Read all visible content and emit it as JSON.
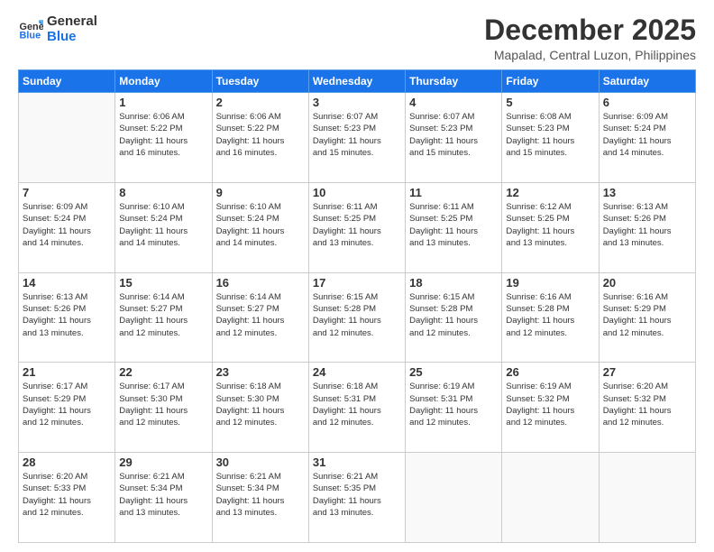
{
  "header": {
    "logo_general": "General",
    "logo_blue": "Blue",
    "main_title": "December 2025",
    "subtitle": "Mapalad, Central Luzon, Philippines"
  },
  "calendar": {
    "days_of_week": [
      "Sunday",
      "Monday",
      "Tuesday",
      "Wednesday",
      "Thursday",
      "Friday",
      "Saturday"
    ],
    "weeks": [
      [
        {
          "day": "",
          "info": ""
        },
        {
          "day": "1",
          "info": "Sunrise: 6:06 AM\nSunset: 5:22 PM\nDaylight: 11 hours\nand 16 minutes."
        },
        {
          "day": "2",
          "info": "Sunrise: 6:06 AM\nSunset: 5:22 PM\nDaylight: 11 hours\nand 16 minutes."
        },
        {
          "day": "3",
          "info": "Sunrise: 6:07 AM\nSunset: 5:23 PM\nDaylight: 11 hours\nand 15 minutes."
        },
        {
          "day": "4",
          "info": "Sunrise: 6:07 AM\nSunset: 5:23 PM\nDaylight: 11 hours\nand 15 minutes."
        },
        {
          "day": "5",
          "info": "Sunrise: 6:08 AM\nSunset: 5:23 PM\nDaylight: 11 hours\nand 15 minutes."
        },
        {
          "day": "6",
          "info": "Sunrise: 6:09 AM\nSunset: 5:24 PM\nDaylight: 11 hours\nand 14 minutes."
        }
      ],
      [
        {
          "day": "7",
          "info": "Sunrise: 6:09 AM\nSunset: 5:24 PM\nDaylight: 11 hours\nand 14 minutes."
        },
        {
          "day": "8",
          "info": "Sunrise: 6:10 AM\nSunset: 5:24 PM\nDaylight: 11 hours\nand 14 minutes."
        },
        {
          "day": "9",
          "info": "Sunrise: 6:10 AM\nSunset: 5:24 PM\nDaylight: 11 hours\nand 14 minutes."
        },
        {
          "day": "10",
          "info": "Sunrise: 6:11 AM\nSunset: 5:25 PM\nDaylight: 11 hours\nand 13 minutes."
        },
        {
          "day": "11",
          "info": "Sunrise: 6:11 AM\nSunset: 5:25 PM\nDaylight: 11 hours\nand 13 minutes."
        },
        {
          "day": "12",
          "info": "Sunrise: 6:12 AM\nSunset: 5:25 PM\nDaylight: 11 hours\nand 13 minutes."
        },
        {
          "day": "13",
          "info": "Sunrise: 6:13 AM\nSunset: 5:26 PM\nDaylight: 11 hours\nand 13 minutes."
        }
      ],
      [
        {
          "day": "14",
          "info": "Sunrise: 6:13 AM\nSunset: 5:26 PM\nDaylight: 11 hours\nand 13 minutes."
        },
        {
          "day": "15",
          "info": "Sunrise: 6:14 AM\nSunset: 5:27 PM\nDaylight: 11 hours\nand 12 minutes."
        },
        {
          "day": "16",
          "info": "Sunrise: 6:14 AM\nSunset: 5:27 PM\nDaylight: 11 hours\nand 12 minutes."
        },
        {
          "day": "17",
          "info": "Sunrise: 6:15 AM\nSunset: 5:28 PM\nDaylight: 11 hours\nand 12 minutes."
        },
        {
          "day": "18",
          "info": "Sunrise: 6:15 AM\nSunset: 5:28 PM\nDaylight: 11 hours\nand 12 minutes."
        },
        {
          "day": "19",
          "info": "Sunrise: 6:16 AM\nSunset: 5:28 PM\nDaylight: 11 hours\nand 12 minutes."
        },
        {
          "day": "20",
          "info": "Sunrise: 6:16 AM\nSunset: 5:29 PM\nDaylight: 11 hours\nand 12 minutes."
        }
      ],
      [
        {
          "day": "21",
          "info": "Sunrise: 6:17 AM\nSunset: 5:29 PM\nDaylight: 11 hours\nand 12 minutes."
        },
        {
          "day": "22",
          "info": "Sunrise: 6:17 AM\nSunset: 5:30 PM\nDaylight: 11 hours\nand 12 minutes."
        },
        {
          "day": "23",
          "info": "Sunrise: 6:18 AM\nSunset: 5:30 PM\nDaylight: 11 hours\nand 12 minutes."
        },
        {
          "day": "24",
          "info": "Sunrise: 6:18 AM\nSunset: 5:31 PM\nDaylight: 11 hours\nand 12 minutes."
        },
        {
          "day": "25",
          "info": "Sunrise: 6:19 AM\nSunset: 5:31 PM\nDaylight: 11 hours\nand 12 minutes."
        },
        {
          "day": "26",
          "info": "Sunrise: 6:19 AM\nSunset: 5:32 PM\nDaylight: 11 hours\nand 12 minutes."
        },
        {
          "day": "27",
          "info": "Sunrise: 6:20 AM\nSunset: 5:32 PM\nDaylight: 11 hours\nand 12 minutes."
        }
      ],
      [
        {
          "day": "28",
          "info": "Sunrise: 6:20 AM\nSunset: 5:33 PM\nDaylight: 11 hours\nand 12 minutes."
        },
        {
          "day": "29",
          "info": "Sunrise: 6:21 AM\nSunset: 5:34 PM\nDaylight: 11 hours\nand 13 minutes."
        },
        {
          "day": "30",
          "info": "Sunrise: 6:21 AM\nSunset: 5:34 PM\nDaylight: 11 hours\nand 13 minutes."
        },
        {
          "day": "31",
          "info": "Sunrise: 6:21 AM\nSunset: 5:35 PM\nDaylight: 11 hours\nand 13 minutes."
        },
        {
          "day": "",
          "info": ""
        },
        {
          "day": "",
          "info": ""
        },
        {
          "day": "",
          "info": ""
        }
      ]
    ]
  }
}
